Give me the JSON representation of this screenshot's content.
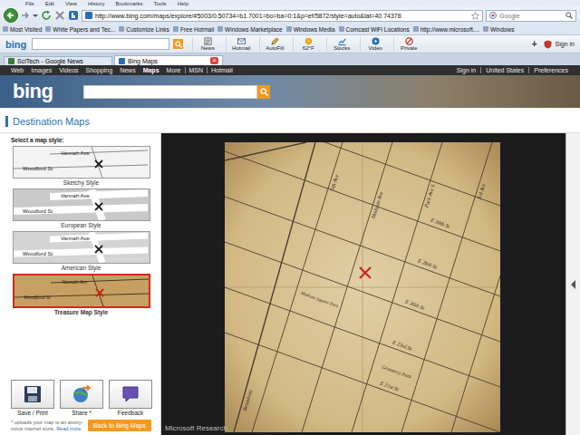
{
  "browser": {
    "menu": [
      "File",
      "Edit",
      "View",
      "History",
      "Bookmarks",
      "Tools",
      "Help"
    ],
    "address": "http://www.bing.com/maps/explore/#5003/0.50734=b1.7001=bo=ba=0:1&p=ef/5872/style=auto&lat=40.74378",
    "search_placeholder": "Google",
    "bookmarks": [
      "Most Visited",
      "White Papers and Tec...",
      "Customize Links",
      "Free Hotmail",
      "Windows Marketplace",
      "Windows Media",
      "Comcast WiFi Locations",
      "http://www.microsoft....",
      "Windows"
    ],
    "toolbar": {
      "logo": "bing",
      "buttons": [
        "News",
        "Hotmail",
        "AutoFill",
        "62°F",
        "Stocks",
        "Video",
        "Private"
      ],
      "add": "+",
      "sign_in": "Sign in"
    },
    "tabs": [
      {
        "label": "SciTech - Google News",
        "selected": false
      },
      {
        "label": "Bing Maps",
        "selected": true
      }
    ],
    "tab_close": "×"
  },
  "site": {
    "logo": "bing",
    "nav": [
      {
        "label": "Web",
        "selected": false
      },
      {
        "label": "Images",
        "selected": false
      },
      {
        "label": "Videos",
        "selected": false
      },
      {
        "label": "Shopping",
        "selected": false
      },
      {
        "label": "News",
        "selected": false
      },
      {
        "label": "Maps",
        "selected": true
      },
      {
        "label": "More",
        "selected": false
      },
      {
        "label": "MSN",
        "selected": false
      },
      {
        "label": "Hotmail",
        "selected": false
      }
    ],
    "account": [
      "Sign in",
      "United States",
      "Preferences"
    ]
  },
  "page": {
    "title": "Destination Maps",
    "prompt": "Select a map style:",
    "styles": [
      {
        "label": "Sketchy Style",
        "kind": "sketchy",
        "selected": false,
        "streets": [
          "Vannah Ave",
          "Woodford St"
        ]
      },
      {
        "label": "European Style",
        "kind": "european",
        "selected": false,
        "streets": [
          "Vannah Ave",
          "Woodford St"
        ]
      },
      {
        "label": "American Style",
        "kind": "american",
        "selected": false,
        "streets": [
          "Vannah Ave",
          "Woodford St"
        ]
      },
      {
        "label": "Treasure Map Style",
        "kind": "treasure",
        "selected": true,
        "streets": [
          "Vannah Ave",
          "Woodford St"
        ]
      }
    ],
    "actions": [
      "Save / Print",
      "Share *",
      "Feedback"
    ],
    "note": "* uploads your map to an anony-mous internet store.",
    "note_link": "Read more",
    "back": "Back to Bing Maps"
  },
  "map": {
    "labels": [
      "5th Ave",
      "Madison Ave",
      "Park Ave S",
      "3rd Ave",
      "E 30th St",
      "E 28th St",
      "E 26th St",
      "E 23rd St",
      "E 21st St",
      "Broadway",
      "Madison Square Park",
      "Gramercy Park"
    ],
    "credit": "Microsoft Research"
  }
}
